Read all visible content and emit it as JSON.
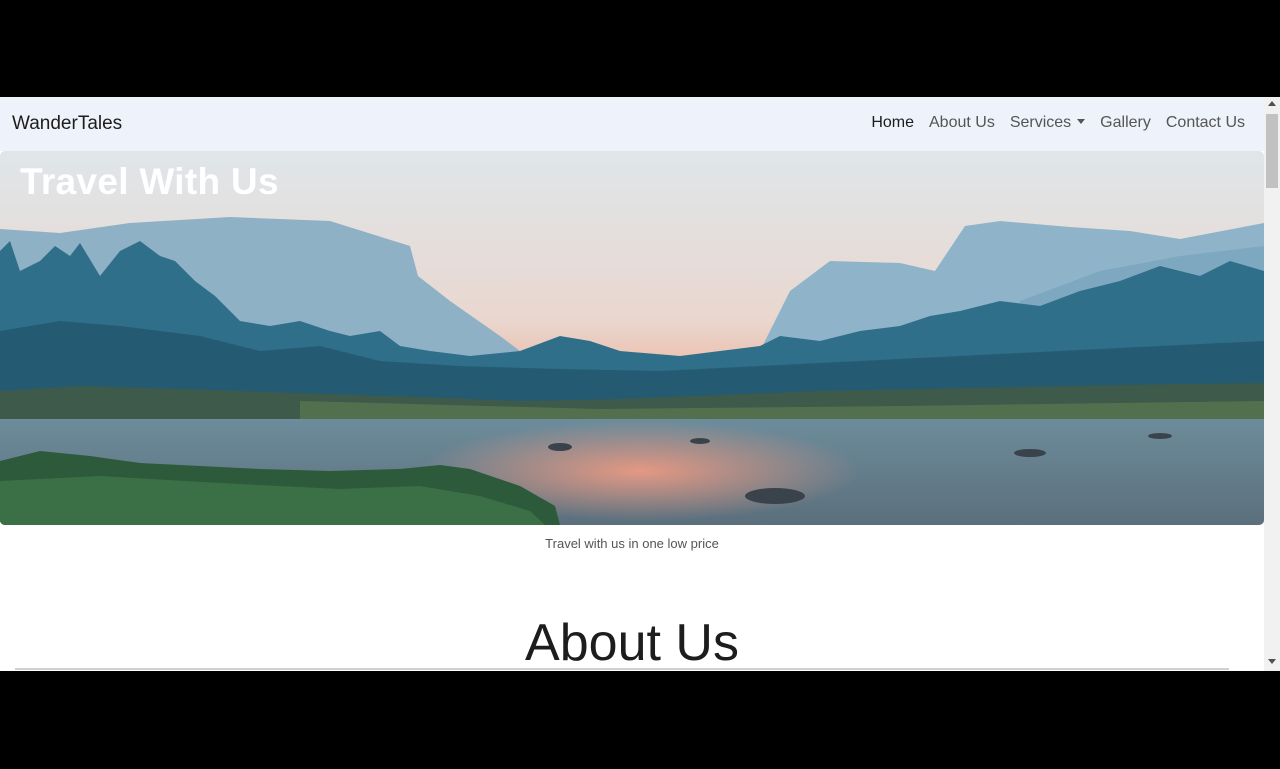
{
  "navbar": {
    "brand": "WanderTales",
    "links": [
      {
        "label": "Home",
        "active": true
      },
      {
        "label": "About Us"
      },
      {
        "label": "Services",
        "dropdown": true
      },
      {
        "label": "Gallery"
      },
      {
        "label": "Contact Us"
      }
    ]
  },
  "hero": {
    "title": "Travel With Us",
    "image": "mountain-lake-sunset-photo"
  },
  "tagline": "Travel with us in one low price",
  "about": {
    "heading": "About Us"
  },
  "colors": {
    "navbar_bg": "#eef2fa",
    "text_dark": "#1d1d1d",
    "link": "#555555"
  },
  "scrollbar": {
    "up_icon": "scroll-up-arrow-icon",
    "down_icon": "scroll-down-arrow-icon"
  }
}
